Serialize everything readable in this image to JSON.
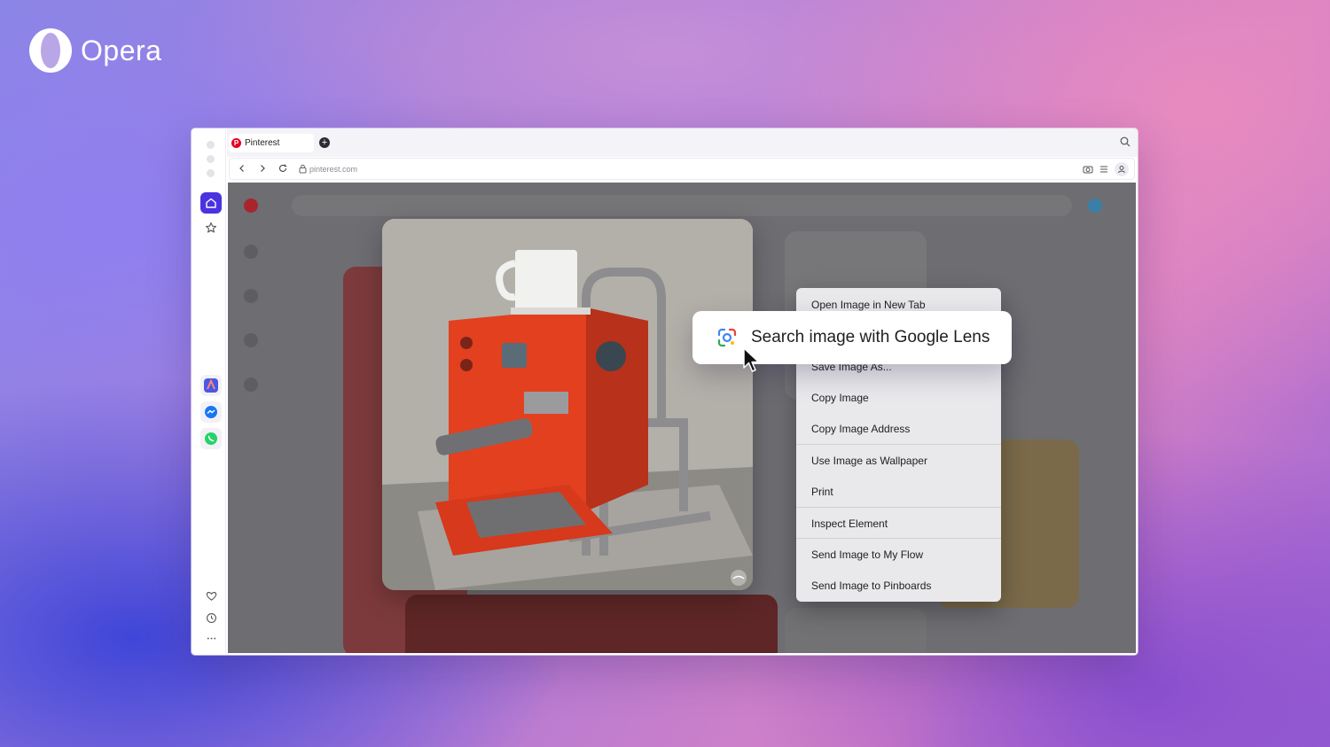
{
  "brand": {
    "name": "Opera"
  },
  "browser": {
    "tab": {
      "label": "Pinterest"
    },
    "address": {
      "url": "pinterest.com"
    },
    "accent_color": "#4b33e0"
  },
  "sidebar": {
    "items": [
      {
        "icon": "home-icon"
      },
      {
        "icon": "bookmark-star-icon"
      },
      {
        "icon": "aria-app-icon"
      },
      {
        "icon": "messenger-icon"
      },
      {
        "icon": "whatsapp-icon"
      },
      {
        "icon": "heart-icon"
      },
      {
        "icon": "history-clock-icon"
      },
      {
        "icon": "more-icon"
      }
    ]
  },
  "context_menu": {
    "items": [
      "Open Image in New Tab",
      "Save Image As...",
      "Copy Image",
      "Copy Image Address",
      "Use Image as Wallpaper",
      "Print",
      "Inspect Element",
      "Send Image to My Flow",
      "Send Image to Pinboards"
    ]
  },
  "lens_callout": {
    "label": "Search image with Google Lens"
  }
}
